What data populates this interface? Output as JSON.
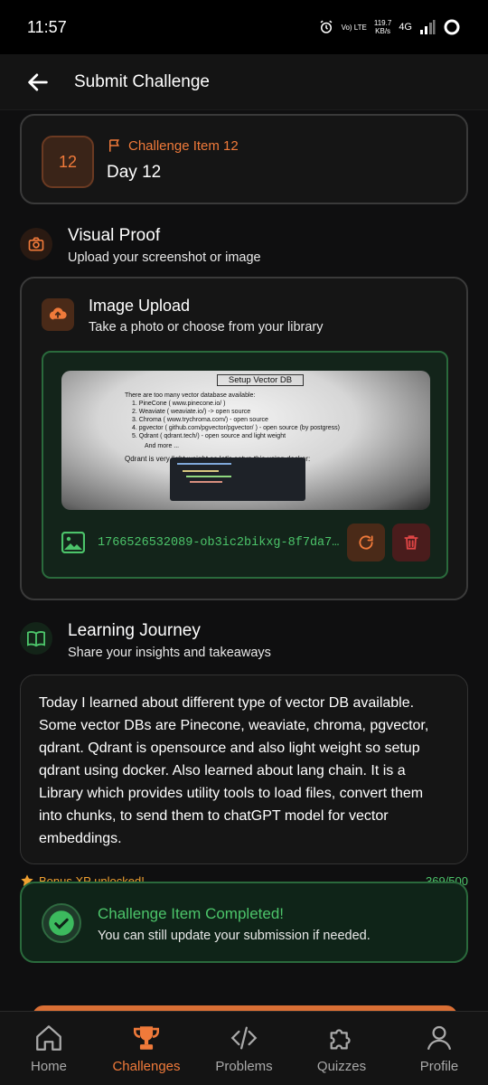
{
  "status_bar": {
    "time": "11:57",
    "volte": "Vo) LTE",
    "speed_top": "119.7",
    "speed_bottom": "KB/s",
    "network": "4G"
  },
  "header": {
    "title": "Submit Challenge"
  },
  "challenge": {
    "number": "12",
    "item_label": "Challenge Item 12",
    "day": "Day 12"
  },
  "visual_proof": {
    "title": "Visual Proof",
    "subtitle": "Upload your screenshot or image"
  },
  "image_upload": {
    "title": "Image Upload",
    "subtitle": "Take a photo or choose from your library",
    "file_name": "1766526532089-ob3ic2bikxg-8f7da7…",
    "preview": {
      "title": "Setup Vector DB",
      "intro": "There are too many vector database available:",
      "lines": [
        "1. PineCone ( www.pinecone.io/ )",
        "2. Weaviate ( weaviate.io/) -> open source",
        "3. Chroma ( www.trychroma.com/) - open source",
        "4. pgvector ( github.com/pgvector/pgvector/ ) - open source (by postgress)",
        "5. Qdrant ( qdrant.tech/) - open source and light weight"
      ],
      "more": "And more ...",
      "note": "Qdrant is very light weight so let's setup this using docker:"
    }
  },
  "learning_journey": {
    "title": "Learning Journey",
    "subtitle": "Share your insights and takeaways",
    "text": "Today I learned about different type of vector DB available. Some vector DBs are Pinecone, weaviate, chroma, pgvector, qdrant. Qdrant is opensource and also light weight so setup qdrant using docker. Also learned about lang chain. It is a Library which provides utility tools to load files, convert them into chunks, to send them to chatGPT model for vector embeddings.",
    "bonus": "Bonus XP unlocked!",
    "char_count": "369/500"
  },
  "completed": {
    "title": "Challenge Item Completed!",
    "subtitle": "You can still update your submission if needed."
  },
  "nav": {
    "items": [
      {
        "label": "Home",
        "icon": "home-icon"
      },
      {
        "label": "Challenges",
        "icon": "trophy-icon"
      },
      {
        "label": "Problems",
        "icon": "code-icon"
      },
      {
        "label": "Quizzes",
        "icon": "puzzle-icon"
      },
      {
        "label": "Profile",
        "icon": "user-icon"
      }
    ],
    "active_index": 1
  },
  "colors": {
    "accent": "#f07a3a",
    "success": "#4cc46a",
    "danger": "#e04545",
    "background": "#0f0f10"
  }
}
